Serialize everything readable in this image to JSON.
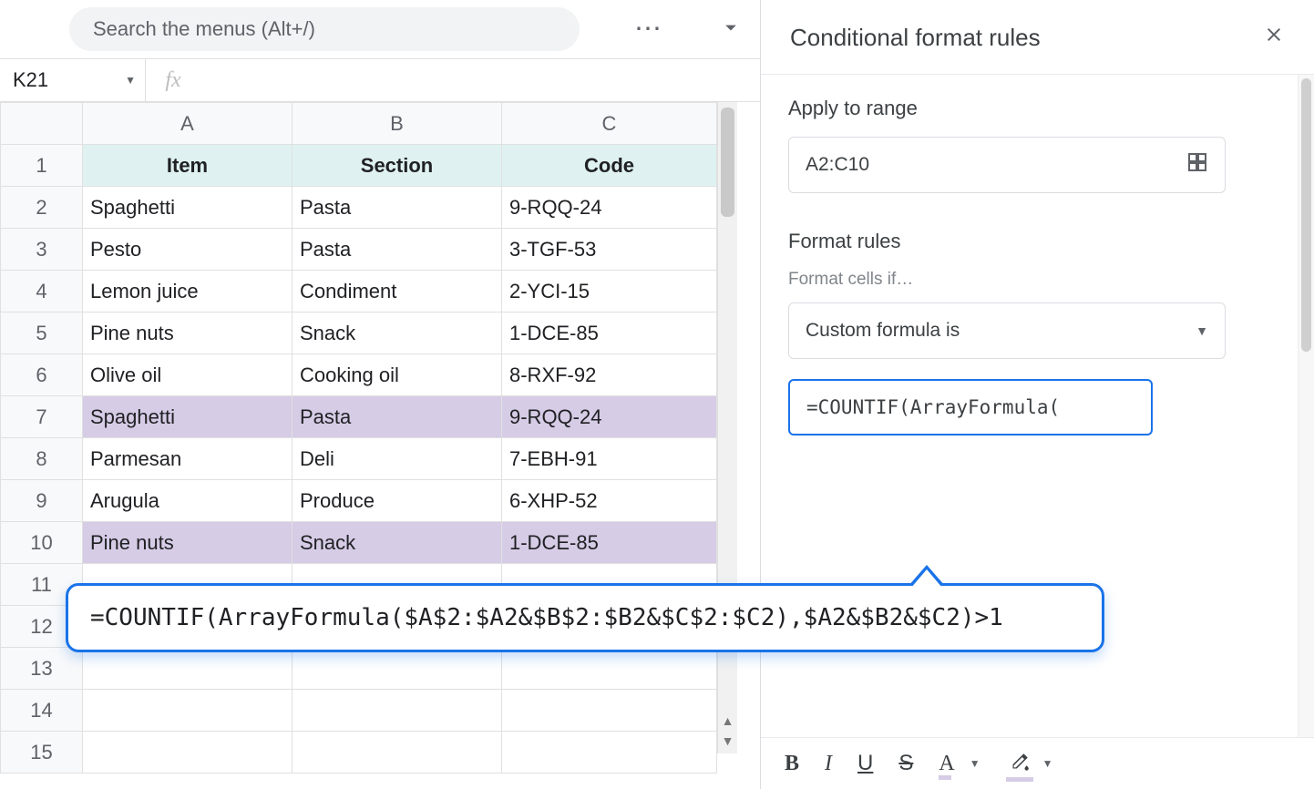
{
  "toolbar": {
    "search_placeholder": "Search the menus (Alt+/)"
  },
  "name_box": "K21",
  "columns": [
    "A",
    "B",
    "C"
  ],
  "headers": {
    "item": "Item",
    "section": "Section",
    "code": "Code"
  },
  "rows": [
    {
      "n": 1
    },
    {
      "n": 2,
      "item": "Spaghetti",
      "section": "Pasta",
      "code": "9-RQQ-24",
      "hl": false
    },
    {
      "n": 3,
      "item": "Pesto",
      "section": "Pasta",
      "code": "3-TGF-53",
      "hl": false
    },
    {
      "n": 4,
      "item": "Lemon juice",
      "section": "Condiment",
      "code": "2-YCI-15",
      "hl": false
    },
    {
      "n": 5,
      "item": "Pine nuts",
      "section": "Snack",
      "code": "1-DCE-85",
      "hl": false
    },
    {
      "n": 6,
      "item": "Olive oil",
      "section": "Cooking oil",
      "code": "8-RXF-92",
      "hl": false
    },
    {
      "n": 7,
      "item": "Spaghetti",
      "section": "Pasta",
      "code": "9-RQQ-24",
      "hl": true
    },
    {
      "n": 8,
      "item": "Parmesan",
      "section": "Deli",
      "code": "7-EBH-91",
      "hl": false
    },
    {
      "n": 9,
      "item": "Arugula",
      "section": "Produce",
      "code": "6-XHP-52",
      "hl": false
    },
    {
      "n": 10,
      "item": "Pine nuts",
      "section": "Snack",
      "code": "1-DCE-85",
      "hl": true
    },
    {
      "n": 11
    },
    {
      "n": 12
    },
    {
      "n": 13
    },
    {
      "n": 14
    },
    {
      "n": 15
    }
  ],
  "panel": {
    "title": "Conditional format rules",
    "apply_label": "Apply to range",
    "range_value": "A2:C10",
    "rules_label": "Format rules",
    "cells_if_label": "Format cells if…",
    "condition_value": "Custom formula is",
    "formula_value_short": "=COUNTIF(ArrayFormula(",
    "format_buttons": {
      "bold": "B",
      "italic": "I",
      "underline": "U",
      "strike": "S",
      "text_color": "A"
    }
  },
  "tooltip_formula": "=COUNTIF(ArrayFormula($A$2:$A2&$B$2:$B2&$C$2:$C2),$A2&$B2&$C2)>1"
}
